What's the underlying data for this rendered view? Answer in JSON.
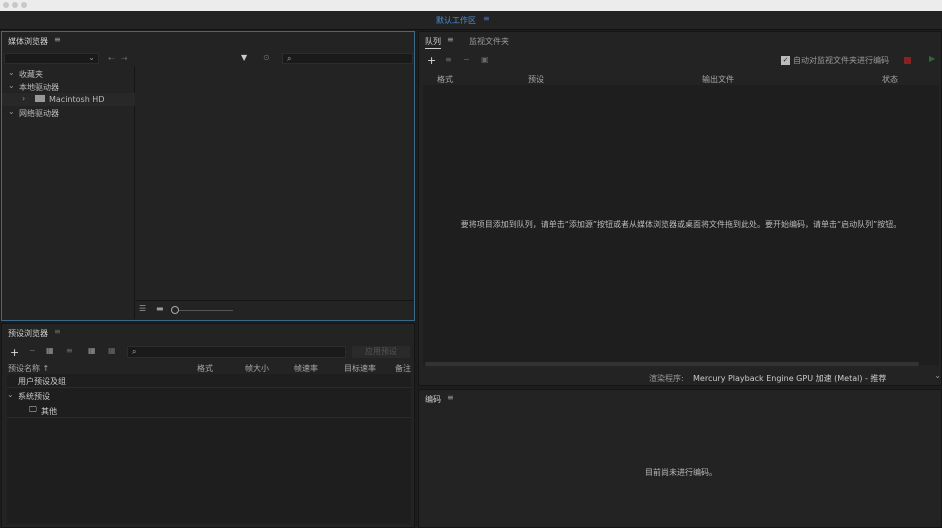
{
  "workspace": {
    "title": "默认工作区"
  },
  "media_browser": {
    "title": "媒体浏览器",
    "tree": [
      {
        "label": "收藏夹",
        "indent": 0,
        "chevron": "⌄"
      },
      {
        "label": "本地驱动器",
        "indent": 0,
        "chevron": "⌄"
      },
      {
        "label": "Macintosh HD",
        "indent": 1,
        "chevron": "›"
      },
      {
        "label": "网络驱动器",
        "indent": 0,
        "chevron": "⌄"
      }
    ]
  },
  "queue": {
    "tabs": [
      "队列",
      "监视文件夹"
    ],
    "auto_encode_label": "自动对监视文件夹进行编码",
    "auto_encode_checked": true,
    "columns": [
      "格式",
      "预设",
      "输出文件",
      "状态"
    ],
    "empty_message": "要将项目添加到队列，请单击“添加源”按钮或者从媒体浏览器或桌面将文件拖到此处。要开始编码，请单击“启动队列”按钮。",
    "renderer_label": "渲染程序:",
    "renderer_value": "Mercury Playback Engine GPU 加速 (Metal) - 推荐"
  },
  "encoding": {
    "title": "编码",
    "empty_message": "目前尚未进行编码。"
  },
  "preset_browser": {
    "title": "预设浏览器",
    "apply_button": "应用预设",
    "columns": [
      "预设名称",
      "格式",
      "帧大小",
      "帧速率",
      "目标速率",
      "备注"
    ],
    "rows": [
      {
        "label": "用户预设及组"
      },
      {
        "label": "系统预设"
      },
      {
        "label": "其他"
      }
    ]
  },
  "colors": {
    "accent": "#4a90d9",
    "focus_border": "#3d6a8a",
    "record": "#8a2020",
    "play": "#2e6b2e"
  }
}
